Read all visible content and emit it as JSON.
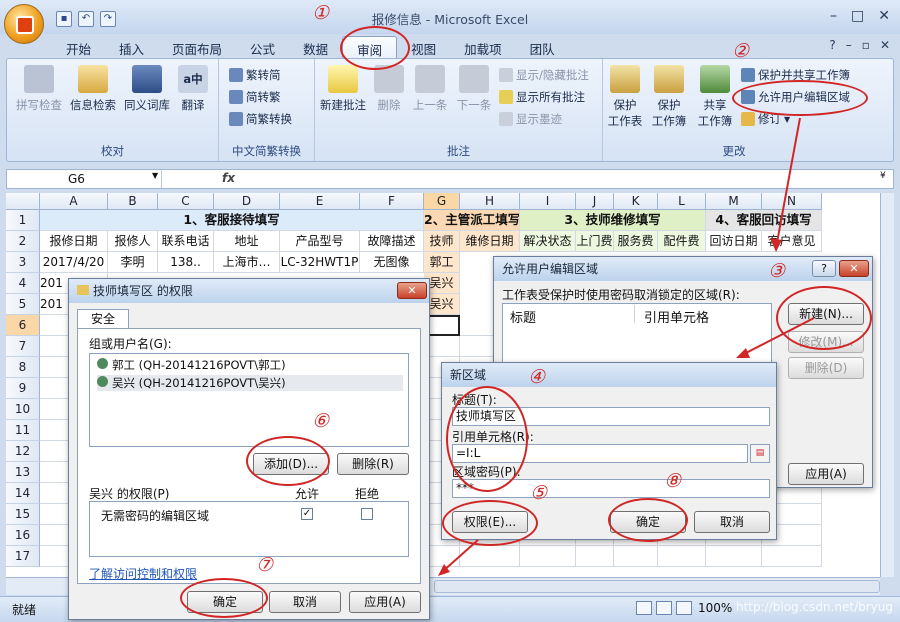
{
  "window": {
    "title": "报修信息 - Microsoft Excel"
  },
  "ribbon_tabs": [
    "开始",
    "插入",
    "页面布局",
    "公式",
    "数据",
    "审阅",
    "视图",
    "加载项",
    "团队"
  ],
  "active_tab": "审阅",
  "ribbon": {
    "proofing": {
      "label": "校对",
      "buttons": [
        "拼写检查",
        "信息检索",
        "同义词库",
        "翻译"
      ]
    },
    "chinese": {
      "label": "中文简繁转换",
      "buttons": [
        "繁转简",
        "简转繁",
        "简繁转换"
      ]
    },
    "comments": {
      "label": "批注",
      "new": "新建批注",
      "delete": "删除",
      "prev": "上一条",
      "next": "下一条",
      "show_hide": "显示/隐藏批注",
      "show_all": "显示所有批注",
      "show_ink": "显示墨迹"
    },
    "changes": {
      "label": "更改",
      "protect_sheet": "保护\n工作表",
      "protect_wb": "保护\n工作簿",
      "share_wb": "共享\n工作簿",
      "protect_share": "保护并共享工作簿",
      "allow_edit": "允许用户编辑区域",
      "track": "修订"
    }
  },
  "formula_bar": {
    "namebox": "G6",
    "fx": "fx",
    "value": ""
  },
  "sheet": {
    "columns": [
      "A",
      "B",
      "C",
      "D",
      "E",
      "F",
      "G",
      "H",
      "I",
      "J",
      "K",
      "L",
      "M",
      "N"
    ],
    "rows": [
      "1",
      "2",
      "3",
      "4",
      "5",
      "6",
      "7",
      "8",
      "9",
      "10",
      "11",
      "12",
      "13",
      "14",
      "15",
      "16",
      "17"
    ],
    "section_headers": [
      "1、客服接待填写",
      "2、主管派工填写",
      "3、技师维修填写",
      "4、客服回访填写"
    ],
    "field_headers": [
      "报修日期",
      "报修人",
      "联系电话",
      "地址",
      "产品型号",
      "故障描述",
      "技师",
      "维修日期",
      "解决状态",
      "上门费",
      "服务费",
      "配件费",
      "回访日期",
      "客户意见"
    ],
    "row3": [
      "2017/4/20",
      "李明",
      "138..",
      "上海市…",
      "LC-32HWT1P",
      "无图像",
      "郭工"
    ],
    "row4": [
      "201",
      "吴兴"
    ],
    "row5": [
      "201",
      "吴兴"
    ]
  },
  "status": {
    "ready": "就绪",
    "zoom": "100%",
    "watermark": "http://blog.csdn.net/bryug"
  },
  "dialog_allow": {
    "title": "允许用户编辑区域",
    "help": "?",
    "desc": "工作表受保护时使用密码取消锁定的区域(R):",
    "col_title": "标题",
    "col_ref": "引用单元格",
    "btn_new": "新建(N)...",
    "btn_modify": "修改(M)...",
    "btn_delete": "删除(D)",
    "btn_apply": "应用(A)"
  },
  "dialog_new": {
    "title": "新区域",
    "title_label": "标题(T):",
    "title_value": "技师填写区",
    "ref_label": "引用单元格(R):",
    "ref_value": "=I:L",
    "pwd_label": "区域密码(P):",
    "pwd_value": "***",
    "btn_perm": "权限(E)...",
    "btn_ok": "确定",
    "btn_cancel": "取消"
  },
  "dialog_perm": {
    "title": "技师填写区 的权限",
    "tab": "安全",
    "group_label": "组或用户名(G):",
    "users": [
      "郭工 (QH-20141216POVT\\郭工)",
      "吴兴 (QH-20141216POVT\\吴兴)"
    ],
    "btn_add": "添加(D)...",
    "btn_remove": "删除(R)",
    "perm_label": "吴兴 的权限(P)",
    "allow": "允许",
    "deny": "拒绝",
    "perm_row": "无需密码的编辑区域",
    "link": "了解访问控制和权限",
    "btn_ok": "确定",
    "btn_cancel": "取消",
    "btn_apply": "应用(A)"
  },
  "annotations": [
    "①",
    "②",
    "③",
    "④",
    "⑤",
    "⑥",
    "⑦",
    "⑧"
  ],
  "colors": {
    "annotation": "#d12626",
    "ribbon": "#d6e3f4",
    "section1": "#dcebfa",
    "section2": "#fbd8b4",
    "section3": "#dff0c6"
  }
}
